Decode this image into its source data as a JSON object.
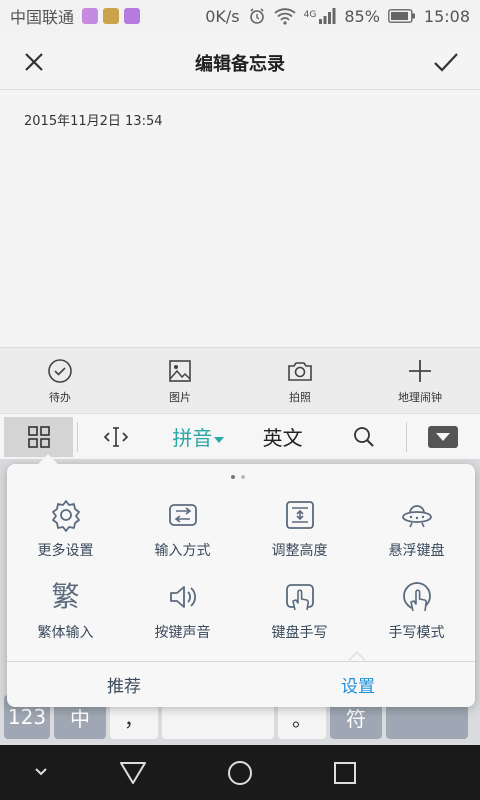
{
  "status_bar": {
    "carrier": "中国联通",
    "speed": "0K/s",
    "network": "4G",
    "battery": "85%",
    "time": "15:08"
  },
  "title_bar": {
    "title": "编辑备忘录",
    "close_icon": "close-icon",
    "confirm_icon": "check-icon"
  },
  "memo": {
    "date": "2015年11月2日 13:54"
  },
  "memo_toolbar": {
    "todo": "待办",
    "image": "图片",
    "photo": "拍照",
    "geo_alarm": "地理闹钟"
  },
  "ime_bar": {
    "pinyin": "拼音",
    "english": "英文"
  },
  "panel": {
    "items": [
      {
        "label": "更多设置",
        "icon": "gear-icon"
      },
      {
        "label": "输入方式",
        "icon": "input-method-icon"
      },
      {
        "label": "调整高度",
        "icon": "adjust-height-icon"
      },
      {
        "label": "悬浮键盘",
        "icon": "ufo-icon"
      },
      {
        "label": "繁体输入",
        "glyph": "繁"
      },
      {
        "label": "按键声音",
        "icon": "speaker-icon"
      },
      {
        "label": "键盘手写",
        "icon": "keyboard-handwriting-icon"
      },
      {
        "label": "手写模式",
        "icon": "handwriting-mode-icon"
      }
    ],
    "tabs": {
      "recommend": "推荐",
      "settings": "设置"
    }
  },
  "keyboard": {
    "num_key": "123",
    "lang_key": "中",
    "comma_key": "，",
    "period_key": "。",
    "enter_key": "符"
  },
  "colors": {
    "accent_teal": "#2aa8a6",
    "active_tab_blue": "#1f8fd8",
    "icon_gray": "#5b6b7d"
  }
}
